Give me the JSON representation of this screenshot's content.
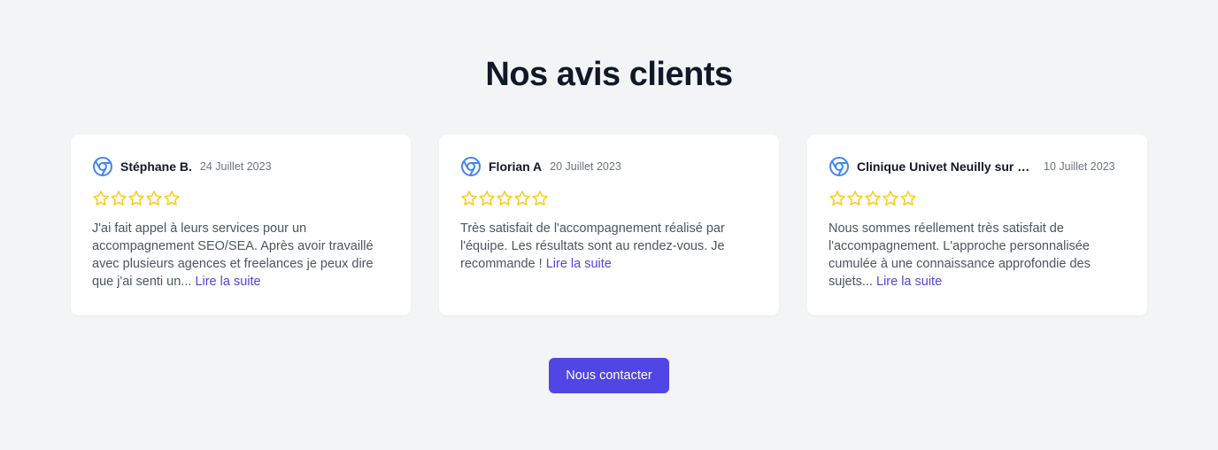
{
  "section": {
    "title": "Nos avis clients"
  },
  "reviews": [
    {
      "author": "Stéphane B.",
      "date": "24 Juillet 2023",
      "rating": 5,
      "icon": "chrome-icon",
      "text": "J'ai fait appel à leurs services pour un accompagnement SEO/SEA. Après avoir travaillé avec plusieurs agences et freelances je peux dire que j'ai senti un... ",
      "more_label": "Lire la suite"
    },
    {
      "author": "Florian A",
      "date": "20 Juillet 2023",
      "rating": 5,
      "icon": "chrome-icon",
      "text": "Très satisfait de l'accompagnement réalisé par l'équipe. Les résultats sont au rendez-vous. Je recommande ! ",
      "more_label": "Lire la suite"
    },
    {
      "author": "Clinique Univet Neuilly sur Seine",
      "date": "10 Juillet 2023",
      "rating": 5,
      "icon": "chrome-icon",
      "text": "Nous sommes réellement très satisfait de l'accompagnement. L'approche personnalisée cumulée à une connaissance approfondie des sujets... ",
      "more_label": "Lire la suite"
    }
  ],
  "cta": {
    "label": "Nous contacter"
  },
  "colors": {
    "background": "#f3f4f6",
    "card": "#ffffff",
    "accent": "#4f46e5",
    "star": "#facc15",
    "icon": "#4285f4"
  }
}
